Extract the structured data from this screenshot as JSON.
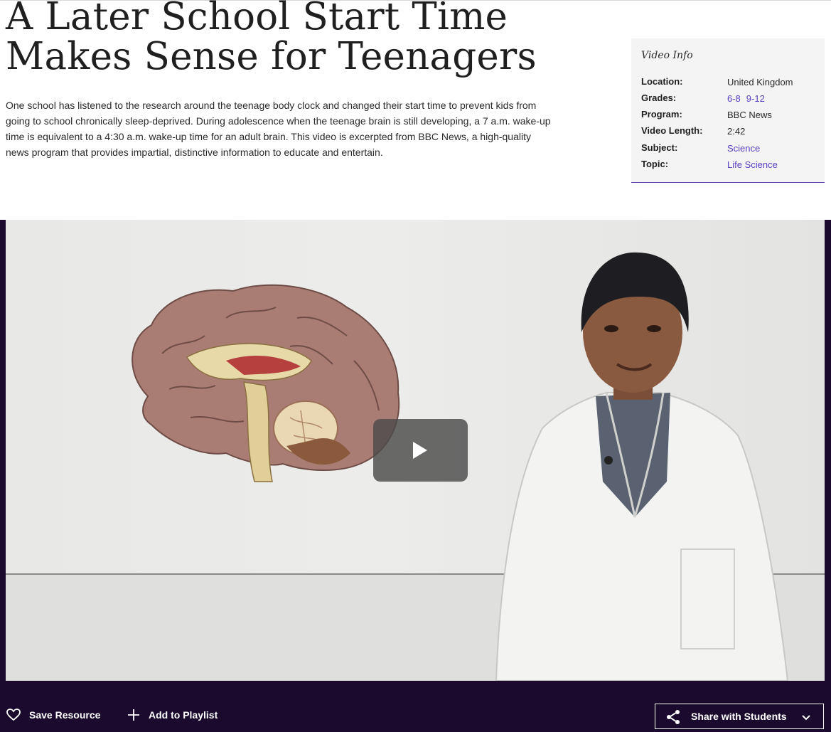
{
  "page": {
    "title": "A Later School Start Time Makes Sense for Teenagers",
    "description": "One school has listened to the research around the teenage body clock and changed their start time to prevent kids from going to school chronically sleep-deprived. During adolescence when the teenage brain is still developing, a 7 a.m. wake-up time is equivalent to a 4:30 a.m. wake-up time for an adult brain. This video is excerpted from BBC News, a high-quality news program that provides impartial, distinctive information to educate and entertain."
  },
  "video_info": {
    "heading": "Video Info",
    "location_label": "Location:",
    "location": "United Kingdom",
    "grades_label": "Grades:",
    "grade_1": "6-8",
    "grade_2": "9-12",
    "program_label": "Program:",
    "program": "BBC News",
    "length_label": "Video Length:",
    "length": "2:42",
    "subject_label": "Subject:",
    "subject": "Science",
    "topic_label": "Topic:",
    "topic": "Life Science"
  },
  "player": {
    "play_icon": "play-icon"
  },
  "actions": {
    "save_label": "Save Resource",
    "save_icon": "heart-icon",
    "playlist_label": "Add to Playlist",
    "playlist_icon": "plus-icon",
    "share_label": "Share with Students",
    "share_icon": "share-icon",
    "share_chevron": "chevron-down-icon"
  },
  "colors": {
    "accent": "#5b3fc2",
    "player_bg": "#1b0a2e",
    "info_bg": "#f4f4f4"
  }
}
